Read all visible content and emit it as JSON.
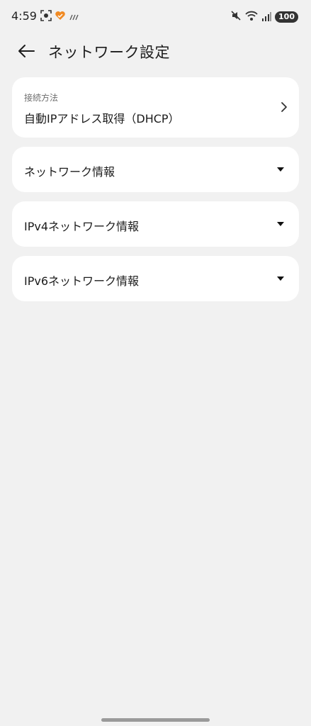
{
  "status_bar": {
    "time": "4:59",
    "battery": "100",
    "left_icons": [
      "screenshot-icon",
      "heart-app-icon",
      "data-activity-icon"
    ],
    "right_icons": [
      "vibrate-mute-icon",
      "wifi-icon",
      "signal-icon",
      "battery-icon"
    ]
  },
  "header": {
    "title": "ネットワーク設定"
  },
  "connection": {
    "label": "接続方法",
    "value": "自動IPアドレス取得（DHCP）"
  },
  "sections": [
    {
      "label": "ネットワーク情報"
    },
    {
      "label": "IPv4ネットワーク情報"
    },
    {
      "label": "IPv6ネットワーク情報"
    }
  ],
  "colors": {
    "background": "#f1f1f1",
    "card": "#ffffff",
    "accent_icon": "#f08a24"
  }
}
